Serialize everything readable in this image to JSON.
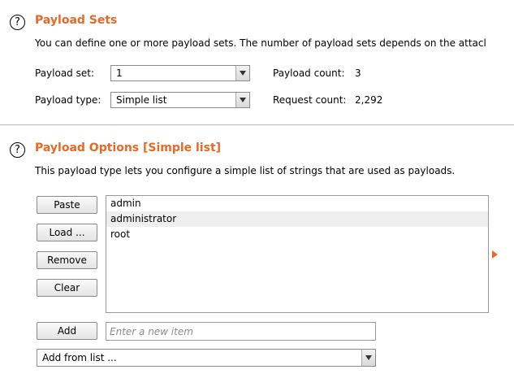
{
  "payload_sets": {
    "title": "Payload Sets",
    "description": "You can define one or more payload sets. The number of payload sets depends on the attacl",
    "payload_set_label": "Payload set:",
    "payload_set_value": "1",
    "payload_type_label": "Payload type:",
    "payload_type_value": "Simple list",
    "payload_count_label": "Payload count:",
    "payload_count_value": "3",
    "request_count_label": "Request count:",
    "request_count_value": "2,292"
  },
  "payload_options": {
    "title": "Payload Options [Simple list]",
    "description": "This payload type lets you configure a simple list of strings that are used as payloads.",
    "buttons": {
      "paste": "Paste",
      "load": "Load ...",
      "remove": "Remove",
      "clear": "Clear",
      "add": "Add"
    },
    "items": [
      "admin",
      "administrator",
      "root"
    ],
    "new_item_placeholder": "Enter a new item",
    "add_from_list_value": "Add from list ..."
  },
  "help_icon_glyph": "?",
  "colors": {
    "accent": "#e56a28",
    "selected_row": "#efefef"
  }
}
